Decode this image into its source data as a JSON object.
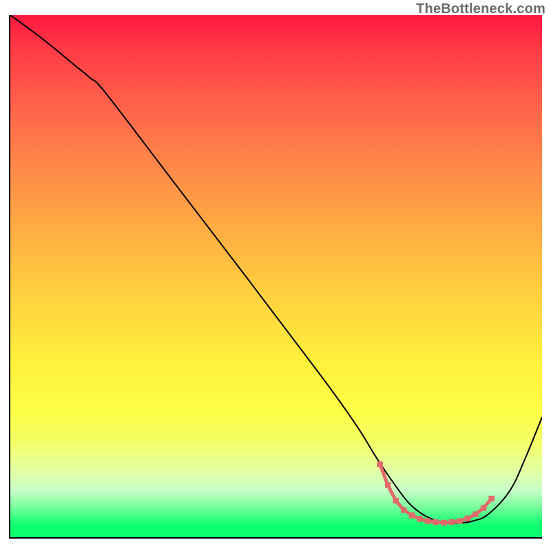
{
  "watermark": "TheBottleneck.com",
  "chart_data": {
    "type": "line",
    "title": "",
    "xlabel": "",
    "ylabel": "",
    "xlim": [
      0,
      100
    ],
    "ylim": [
      0,
      100
    ],
    "grid": false,
    "series": [
      {
        "name": "bottleneck-curve",
        "color": "#000000",
        "x": [
          0,
          6,
          12,
          15,
          18,
          30,
          45,
          58,
          63,
          66,
          69,
          72,
          75,
          78,
          81,
          84,
          87,
          90,
          94,
          97,
          100
        ],
        "y": [
          100,
          95.5,
          90.5,
          88,
          85,
          69,
          49,
          31.5,
          24.5,
          20,
          15,
          10.5,
          6.5,
          4.1,
          3.0,
          2.7,
          3.1,
          4.5,
          9,
          15.5,
          23
        ]
      },
      {
        "name": "target-zone",
        "type": "marker-segment",
        "color": "#e16a6a",
        "marker": "square",
        "x": [
          69.5,
          71,
          72.5,
          74,
          75.5,
          77,
          78.5,
          80,
          81.5,
          83,
          84.5,
          86,
          87.5,
          89,
          90.5
        ],
        "y": [
          14.0,
          10.0,
          7.0,
          5.2,
          4.2,
          3.5,
          3.1,
          2.9,
          2.8,
          2.9,
          3.1,
          3.6,
          4.4,
          5.6,
          7.4
        ]
      }
    ],
    "background_gradient_stops": [
      {
        "pos": 0.0,
        "color": "#ff173f"
      },
      {
        "pos": 0.06,
        "color": "#ff3846"
      },
      {
        "pos": 0.15,
        "color": "#ff5a4a"
      },
      {
        "pos": 0.26,
        "color": "#ff7f4a"
      },
      {
        "pos": 0.39,
        "color": "#ffa644"
      },
      {
        "pos": 0.53,
        "color": "#ffcf3f"
      },
      {
        "pos": 0.67,
        "color": "#fff13c"
      },
      {
        "pos": 0.76,
        "color": "#fdff47"
      },
      {
        "pos": 0.82,
        "color": "#f3ff68"
      },
      {
        "pos": 0.87,
        "color": "#e4ffa2"
      },
      {
        "pos": 0.91,
        "color": "#c8ffc8"
      },
      {
        "pos": 0.94,
        "color": "#7fffa0"
      },
      {
        "pos": 0.965,
        "color": "#2fff7e"
      },
      {
        "pos": 0.98,
        "color": "#0cff6e"
      },
      {
        "pos": 1.0,
        "color": "#0aff6e"
      }
    ]
  }
}
